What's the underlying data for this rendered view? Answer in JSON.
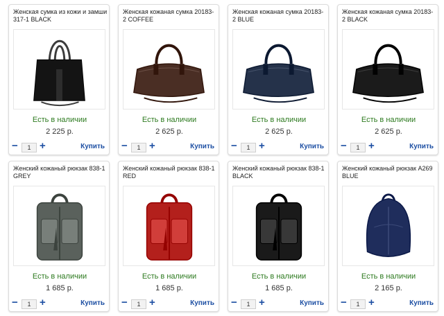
{
  "products": [
    {
      "title": "Женская сумка из кожи и замши 317-1 BLACK",
      "stock": "Есть в наличии",
      "price": "2 225 р.",
      "qty": "1",
      "buy": "Купить",
      "color": "#141414",
      "kind": "bag-tall"
    },
    {
      "title": "Женская кожаная сумка 20183-2 COFFEE",
      "stock": "Есть в наличии",
      "price": "2 625 р.",
      "qty": "1",
      "buy": "Купить",
      "color": "#4a2e24",
      "kind": "bag"
    },
    {
      "title": "Женская кожаная сумка 20183-2 BLUE",
      "stock": "Есть в наличии",
      "price": "2 625 р.",
      "qty": "1",
      "buy": "Купить",
      "color": "#25324a",
      "kind": "bag"
    },
    {
      "title": "Женская кожаная сумка 20183-2 BLACK",
      "stock": "Есть в наличии",
      "price": "2 625 р.",
      "qty": "1",
      "buy": "Купить",
      "color": "#1b1b1b",
      "kind": "bag"
    },
    {
      "title": "Женский кожаный рюкзак 838-1 GREY",
      "stock": "Есть в наличии",
      "price": "1 685 р.",
      "qty": "1",
      "buy": "Купить",
      "color": "#5a615c",
      "kind": "backpack"
    },
    {
      "title": "Женский кожаный рюкзак 838-1 RED",
      "stock": "Есть в наличии",
      "price": "1 685 р.",
      "qty": "1",
      "buy": "Купить",
      "color": "#b3201c",
      "kind": "backpack"
    },
    {
      "title": "Женский кожаный рюкзак 838-1 BLACK",
      "stock": "Есть в наличии",
      "price": "1 685 р.",
      "qty": "1",
      "buy": "Купить",
      "color": "#1a1a1a",
      "kind": "backpack"
    },
    {
      "title": "Женский кожаный рюкзак A269 BLUE",
      "stock": "Есть в наличии",
      "price": "2 165 р.",
      "qty": "1",
      "buy": "Купить",
      "color": "#1f2d5c",
      "kind": "backpack-round"
    }
  ],
  "icons": {
    "minus": "−",
    "plus": "+"
  },
  "accent": "#1d4fa3",
  "stock_color": "#2d7a1f"
}
